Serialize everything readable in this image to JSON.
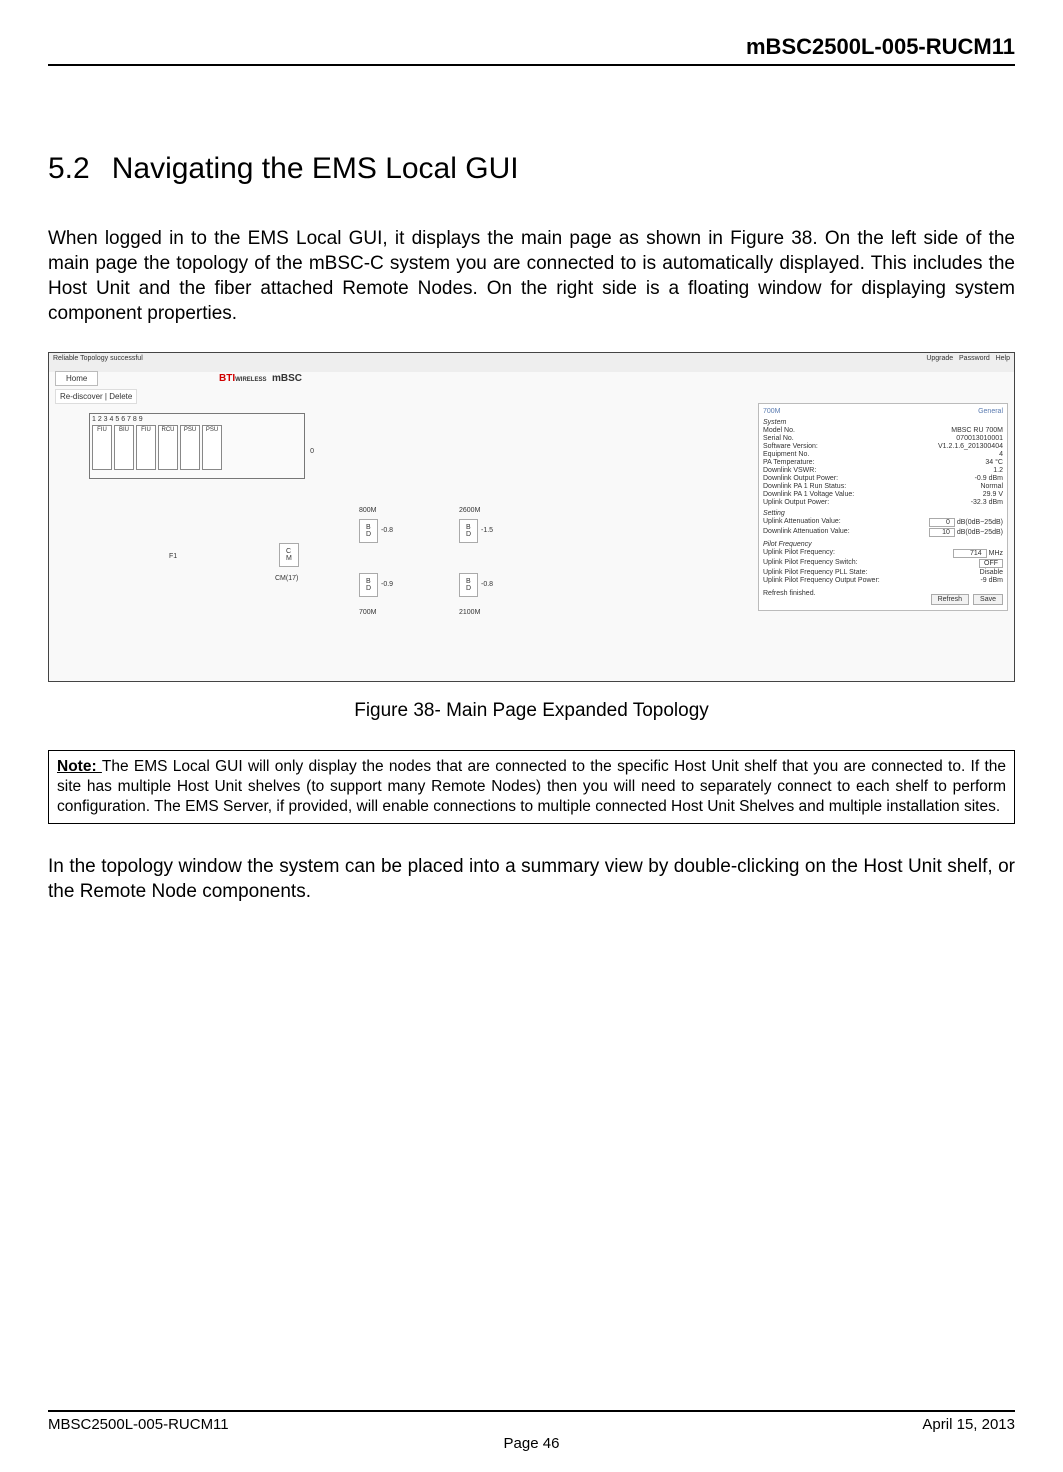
{
  "header": {
    "doc_code": "mBSC2500L-005-RUCM11"
  },
  "section": {
    "number": "5.2",
    "title": "Navigating the EMS Local GUI"
  },
  "para1": "When logged in to the EMS Local GUI, it displays the main page as shown in Figure 38. On the left side of the main page the topology of the mBSC-C system you are connected to is automatically displayed. This includes the Host Unit and the fiber attached Remote Nodes. On the right side is a floating window for displaying system component properties.",
  "figure": {
    "caption": "Figure 38- Main Page Expanded Topology",
    "topbar_left": "Reliable Topology successful",
    "topbar_right": [
      "Upgrade",
      "Password",
      "Help"
    ],
    "home": "Home",
    "logo": {
      "bti": "BTI",
      "sub": "WIRELESS",
      "brand": "mBSC"
    },
    "toolbar": "Re-discover | Delete",
    "shelf": {
      "numbers": "1  2  3  4  5  6  7  8  9",
      "slots": [
        "FIU",
        "BIU",
        "FIU",
        "RCU",
        "PSU",
        "PSU"
      ],
      "label0": "0"
    },
    "topo": {
      "f1": "F1",
      "cm": "CM(17)",
      "n1": {
        "band": "800M",
        "val": "-0.8"
      },
      "n2": {
        "band": "700M",
        "val": "-0.9"
      },
      "n3": {
        "band": "2600M",
        "val": "-1.5"
      },
      "n4": {
        "band": "2100M",
        "val": "-0.8"
      }
    },
    "panel": {
      "title_left": "700M",
      "title_right": "General",
      "system_label": "System",
      "rows": [
        {
          "k": "Model No.",
          "v": "MBSC RU 700M"
        },
        {
          "k": "Serial No.",
          "v": "070013010001"
        },
        {
          "k": "Software Version:",
          "v": "V1.2.1.6_201300404"
        },
        {
          "k": "Equipment No.",
          "v": "4"
        },
        {
          "k": "PA Temperature:",
          "v": "34   °C"
        },
        {
          "k": "Downlink VSWR:",
          "v": "1.2"
        },
        {
          "k": "Downlink Output Power:",
          "v": "-0.9   dBm"
        },
        {
          "k": "Downlink PA 1 Run Status:",
          "v": "Normal"
        },
        {
          "k": "Downlink PA 1 Voltage Value:",
          "v": "29.9   V"
        },
        {
          "k": "Uplink Output Power:",
          "v": "-32.3   dBm"
        }
      ],
      "setting_label": "Setting",
      "setting_rows": [
        {
          "k": "Uplink Attenuation Value:",
          "v": "0",
          "unit": "dB(0dB~25dB)"
        },
        {
          "k": "Downlink Attenuation Value:",
          "v": "10",
          "unit": "dB(0dB~25dB)"
        }
      ],
      "pilot_label": "Pilot Frequency",
      "pilot_rows": [
        {
          "k": "Uplink Pilot Frequency:",
          "v": "714",
          "unit": "MHz"
        },
        {
          "k": "Uplink Pilot Frequency Switch:",
          "v": "OFF"
        },
        {
          "k": "Uplink Pilot Frequency PLL State:",
          "v": "Disable"
        },
        {
          "k": "Uplink Pilot Frequency Output Power:",
          "v": "-9   dBm"
        }
      ],
      "status": "Refresh finished.",
      "btn_refresh": "Refresh",
      "btn_save": "Save"
    }
  },
  "note": {
    "label": "Note: ",
    "text": "The EMS Local GUI will only display the nodes that are connected to the specific Host Unit shelf that you are connected to. If the site has multiple Host Unit shelves (to support many Remote Nodes) then you will need to separately connect to each shelf to perform configuration. The EMS Server, if provided, will enable connections to multiple connected Host Unit Shelves and multiple installation sites."
  },
  "para2": "In the topology window the system can be placed into a summary view by double-clicking on the Host Unit shelf, or the Remote Node components.",
  "footer": {
    "left": "MBSC2500L-005-RUCM11",
    "right": "April 15, 2013",
    "center": "Page 46"
  }
}
